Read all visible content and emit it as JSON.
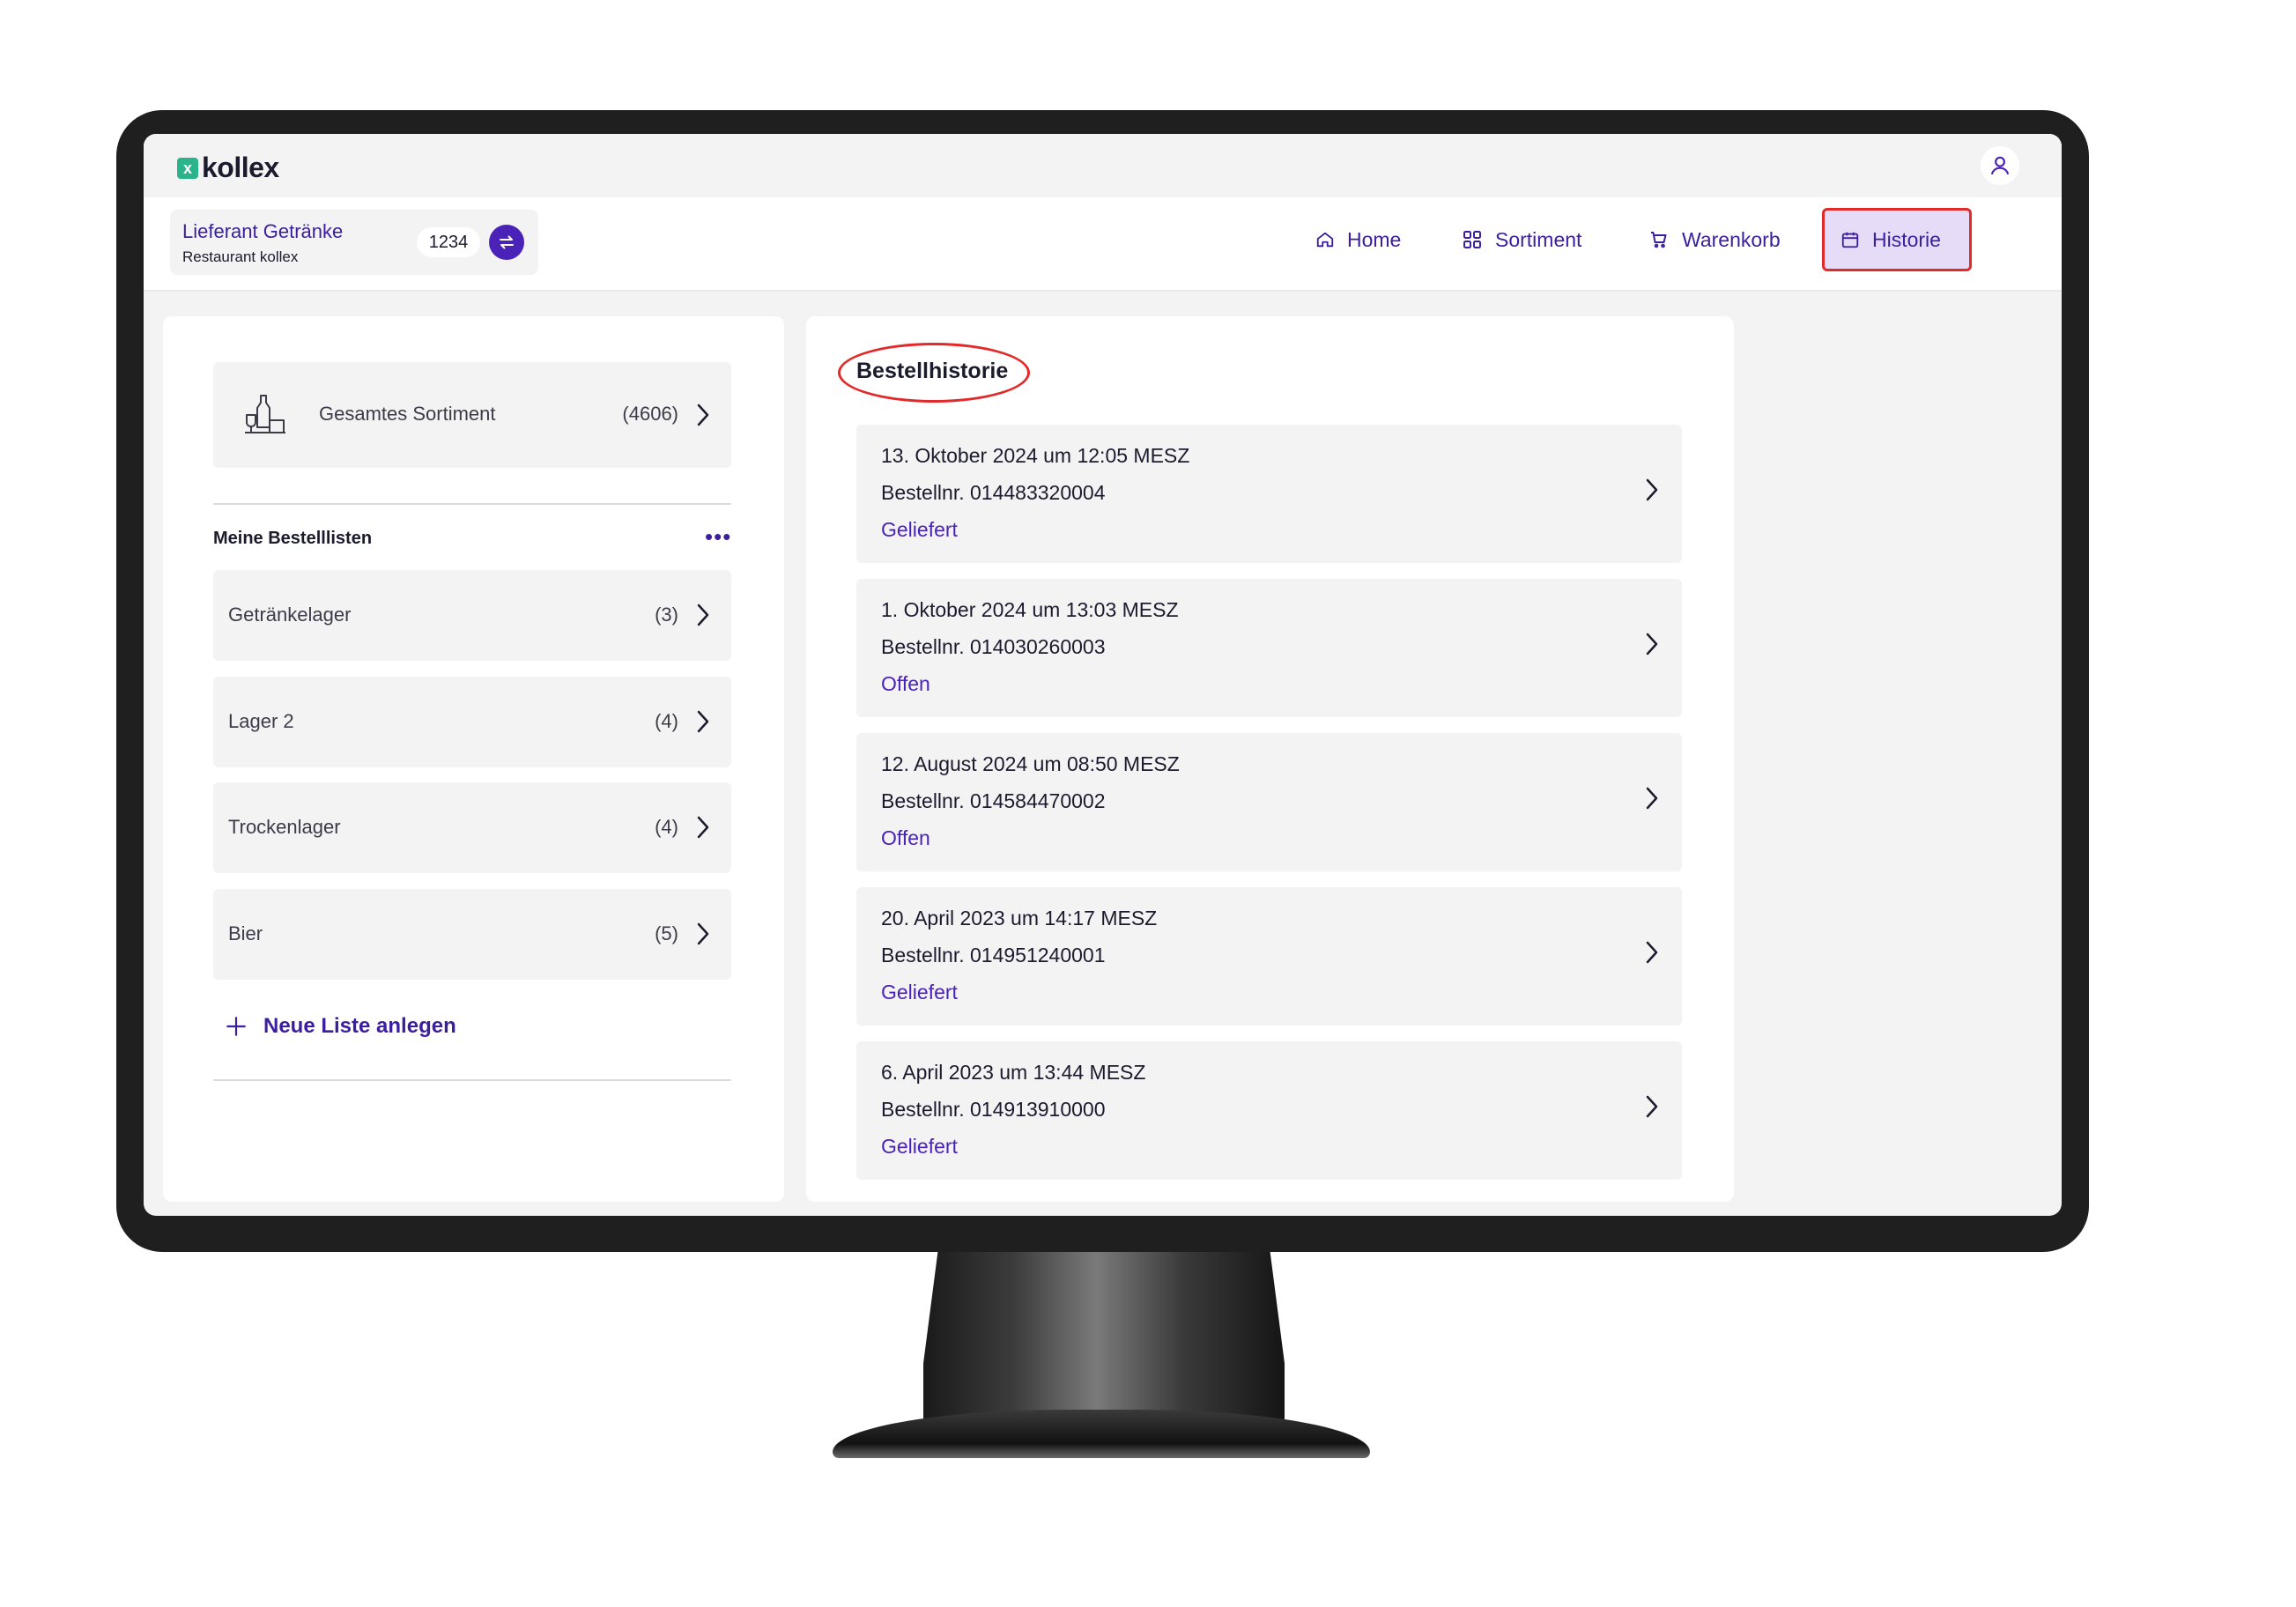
{
  "app": {
    "logo_mark": "x",
    "logo_text": "kollex"
  },
  "supplier": {
    "name": "Lieferant Getränke",
    "restaurant": "Restaurant kollex",
    "customer_number": "1234"
  },
  "nav": {
    "home": "Home",
    "sortiment": "Sortiment",
    "warenkorb": "Warenkorb",
    "historie": "Historie",
    "active": "historie"
  },
  "catalog": {
    "label": "Gesamtes Sortiment",
    "count": "(4606)"
  },
  "lists": {
    "title": "Meine Bestelllisten",
    "items": [
      {
        "label": "Getränkelager",
        "count": "(3)"
      },
      {
        "label": "Lager 2",
        "count": "(4)"
      },
      {
        "label": "Trockenlager",
        "count": "(4)"
      },
      {
        "label": "Bier",
        "count": "(5)"
      }
    ],
    "new_list_label": "Neue Liste anlegen"
  },
  "history": {
    "title": "Bestellhistorie",
    "orders": [
      {
        "date": "13. Oktober 2024 um 12:05 MESZ",
        "number": "Bestellnr. 014483320004",
        "status": "Geliefert"
      },
      {
        "date": "1. Oktober 2024 um 13:03 MESZ",
        "number": "Bestellnr. 014030260003",
        "status": "Offen"
      },
      {
        "date": "12. August 2024 um 08:50 MESZ",
        "number": "Bestellnr. 014584470002",
        "status": "Offen"
      },
      {
        "date": "20. April 2023 um 14:17 MESZ",
        "number": "Bestellnr. 014951240001",
        "status": "Geliefert"
      },
      {
        "date": "6. April 2023 um 13:44 MESZ",
        "number": "Bestellnr. 014913910000",
        "status": "Geliefert"
      }
    ]
  },
  "colors": {
    "accent": "#4a22b8",
    "brand_green": "#2bb48b",
    "highlight_red": "#e32a2a",
    "active_bg": "#e6dcf7"
  }
}
